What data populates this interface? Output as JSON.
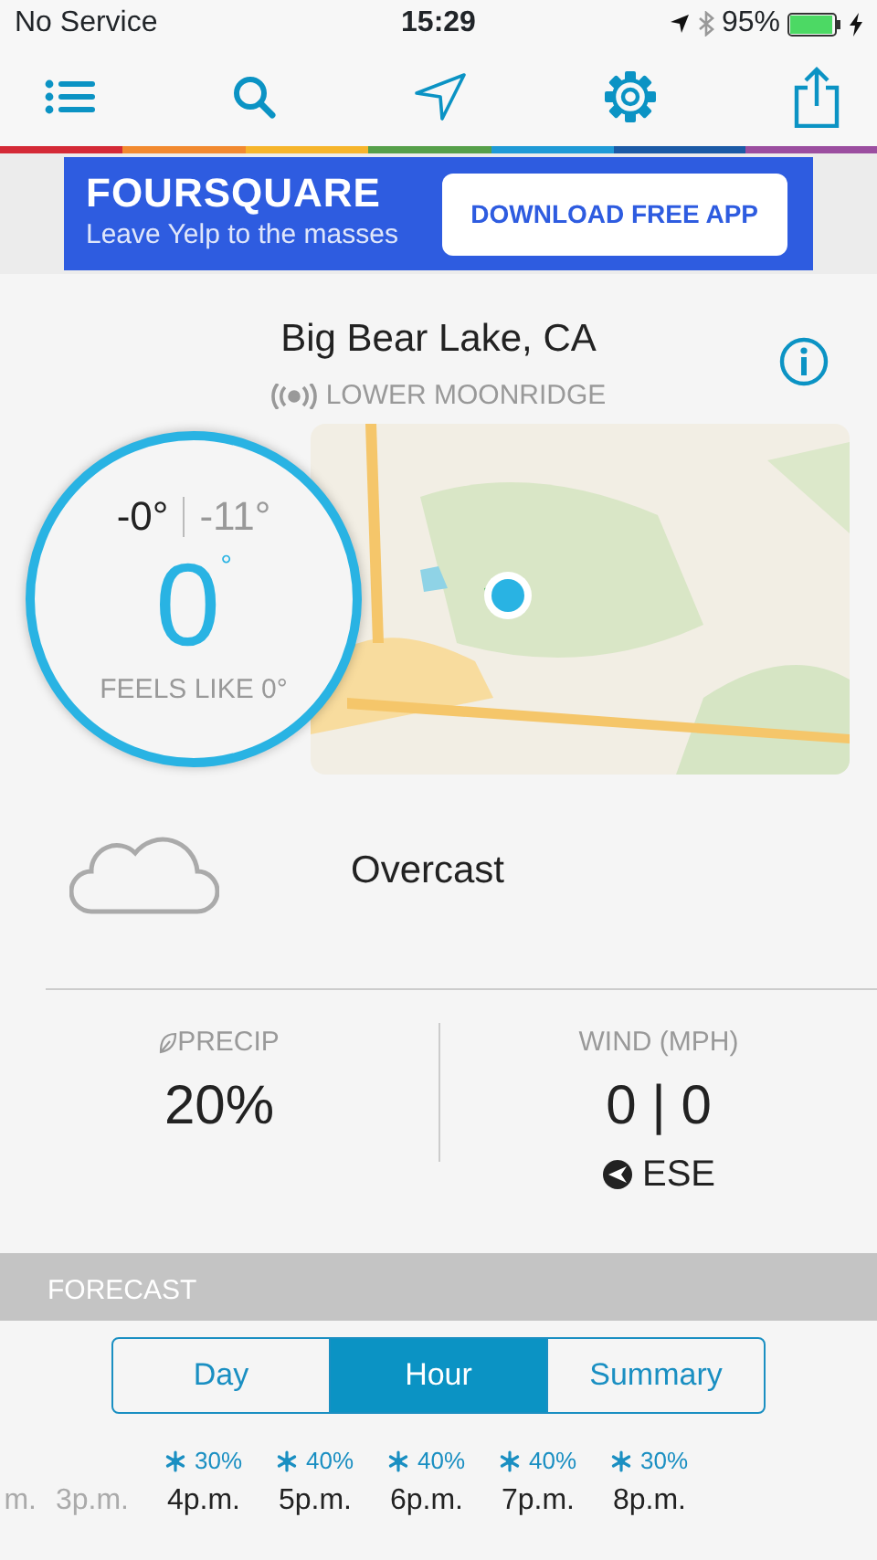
{
  "status_bar": {
    "carrier": "No Service",
    "time": "15:29",
    "battery": "95%"
  },
  "ad": {
    "brand": "FOURSQUARE",
    "tagline": "Leave Yelp to the masses",
    "button": "DOWNLOAD FREE APP"
  },
  "location": {
    "name": "Big Bear Lake, CA",
    "station": "LOWER MOONRIDGE"
  },
  "current": {
    "high": "-0°",
    "low": "-11°",
    "temperature": "0",
    "degree": "°",
    "feels_like": "FEELS LIKE 0°"
  },
  "condition": "Overcast",
  "precip": {
    "label": "PRECIP",
    "value": "20%"
  },
  "wind": {
    "label": "WIND (MPH)",
    "value": "0 | 0",
    "direction": "ESE"
  },
  "forecast": {
    "title": "FORECAST",
    "tabs": [
      {
        "label": "Day",
        "selected": false
      },
      {
        "label": "Hour",
        "selected": true
      },
      {
        "label": "Summary",
        "selected": false
      }
    ],
    "hours": [
      {
        "time": "m.",
        "kind": "cut",
        "past": true
      },
      {
        "time": "3p.m.",
        "kind": "full",
        "past": true
      },
      {
        "time": "4p.m.",
        "kind": "full",
        "past": false,
        "precip": "30%"
      },
      {
        "time": "5p.m.",
        "kind": "full",
        "past": false,
        "precip": "40%"
      },
      {
        "time": "6p.m.",
        "kind": "full",
        "past": false,
        "precip": "40%"
      },
      {
        "time": "7p.m.",
        "kind": "full",
        "past": false,
        "precip": "40%"
      },
      {
        "time": "8p.m.",
        "kind": "full",
        "past": false,
        "precip": "30%"
      }
    ]
  }
}
